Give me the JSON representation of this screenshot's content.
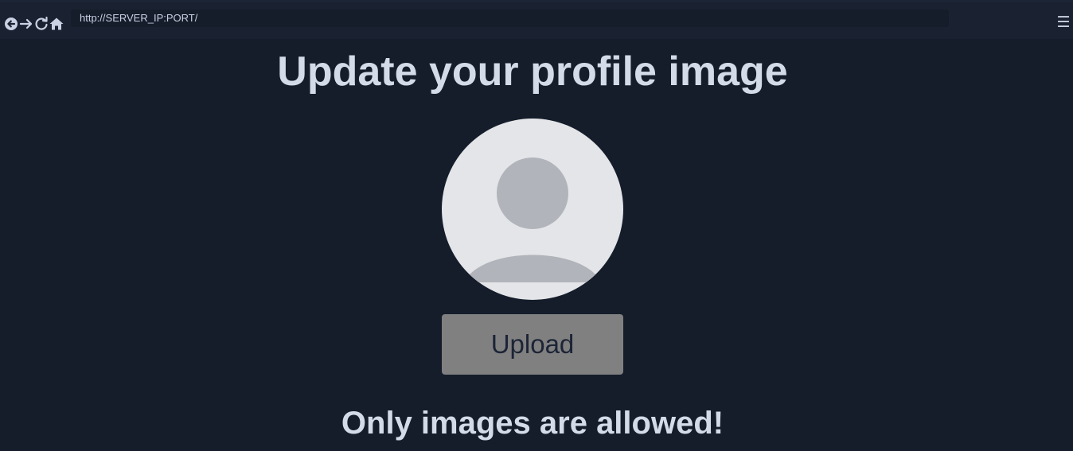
{
  "browser": {
    "url": "http://SERVER_IP:PORT/",
    "icons": [
      "back-icon",
      "forward-icon",
      "reload-icon",
      "home-icon",
      "menu-icon"
    ],
    "menu_glyph": "☰"
  },
  "main": {
    "title": "Update your profile image",
    "upload_label": "Upload",
    "message": "Only images are allowed!"
  },
  "colors": {
    "background": "#151d2b",
    "toolbar": "#1a2232",
    "text": "#d4dbe8",
    "avatar_bg": "#e3e5e8",
    "avatar_figure": "#b1b4ba",
    "button_bg": "#808080",
    "button_text": "#1c2436"
  }
}
